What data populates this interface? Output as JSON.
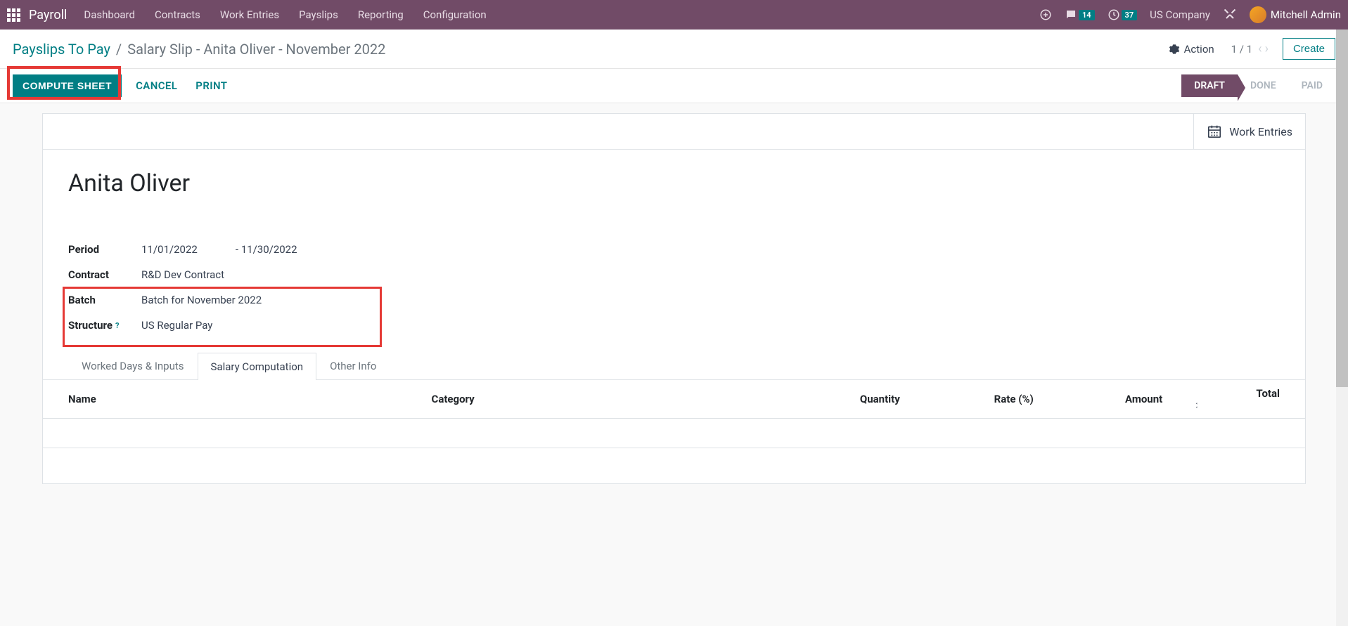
{
  "nav": {
    "app": "Payroll",
    "items": [
      "Dashboard",
      "Contracts",
      "Work Entries",
      "Payslips",
      "Reporting",
      "Configuration"
    ],
    "chat_badge": "14",
    "clock_badge": "37",
    "company": "US Company",
    "user": "Mitchell Admin"
  },
  "breadcrumb": {
    "parent": "Payslips To Pay",
    "current": "Salary Slip - Anita Oliver - November 2022"
  },
  "header": {
    "action_label": "Action",
    "pager": "1 / 1",
    "create_label": "Create"
  },
  "actions": {
    "compute": "COMPUTE SHEET",
    "cancel": "CANCEL",
    "print": "PRINT"
  },
  "status": {
    "draft": "DRAFT",
    "done": "DONE",
    "paid": "PAID"
  },
  "card": {
    "work_entries": "Work Entries",
    "employee": "Anita Oliver",
    "fields": {
      "period_label": "Period",
      "period_from": "11/01/2022",
      "period_dash": "-",
      "period_to": "11/30/2022",
      "contract_label": "Contract",
      "contract_value": "R&D Dev Contract",
      "batch_label": "Batch",
      "batch_value": "Batch for November 2022",
      "structure_label": "Structure",
      "structure_help": "?",
      "structure_value": "US Regular Pay"
    }
  },
  "tabs": {
    "worked": "Worked Days & Inputs",
    "salary": "Salary Computation",
    "other": "Other Info"
  },
  "table": {
    "headers": {
      "name": "Name",
      "category": "Category",
      "quantity": "Quantity",
      "rate": "Rate (%)",
      "amount": "Amount",
      "total": "Total"
    }
  }
}
